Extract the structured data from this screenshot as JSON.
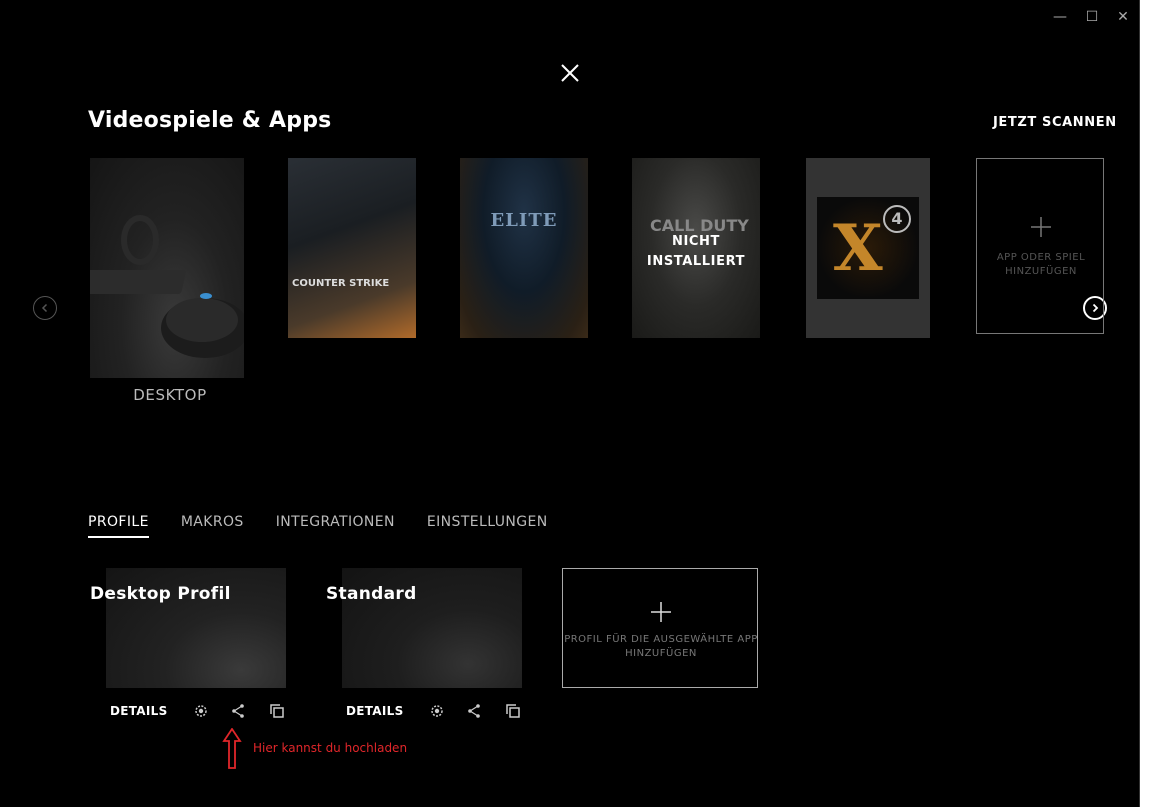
{
  "window_controls": {
    "minimize": "—",
    "maximize": "☐",
    "close": "✕"
  },
  "header": {
    "title": "Videospiele & Apps",
    "scan_label": "JETZT SCANNEN"
  },
  "games": [
    {
      "name": "DESKTOP"
    },
    {
      "cover_text": "COUNTER STRIKE"
    },
    {
      "cover_text": "ELITE"
    },
    {
      "cover_text": "CALL DUTY",
      "overlay": "NICHT INSTALLIERT"
    },
    {
      "cover_text": "X",
      "badge": "4"
    }
  ],
  "add_app": {
    "label": "APP ODER SPIEL HINZUFÜGEN"
  },
  "tabs": [
    "PROFILE",
    "MAKROS",
    "INTEGRATIONEN",
    "EINSTELLUNGEN"
  ],
  "profiles": [
    {
      "name": "Desktop Profil",
      "details": "DETAILS"
    },
    {
      "name": "Standard",
      "details": "DETAILS"
    }
  ],
  "add_profile": {
    "label": "PROFIL FÜR DIE AUSGEWÄHLTE APP HINZUFÜGEN"
  },
  "annotation": {
    "text": "Hier kannst du hochladen",
    "color": "#e0262a"
  },
  "icons": [
    "close-icon",
    "chevron-left-icon",
    "chevron-right-icon",
    "plus-icon",
    "persistent-icon",
    "share-icon",
    "copy-icon",
    "up-arrow-icon"
  ]
}
